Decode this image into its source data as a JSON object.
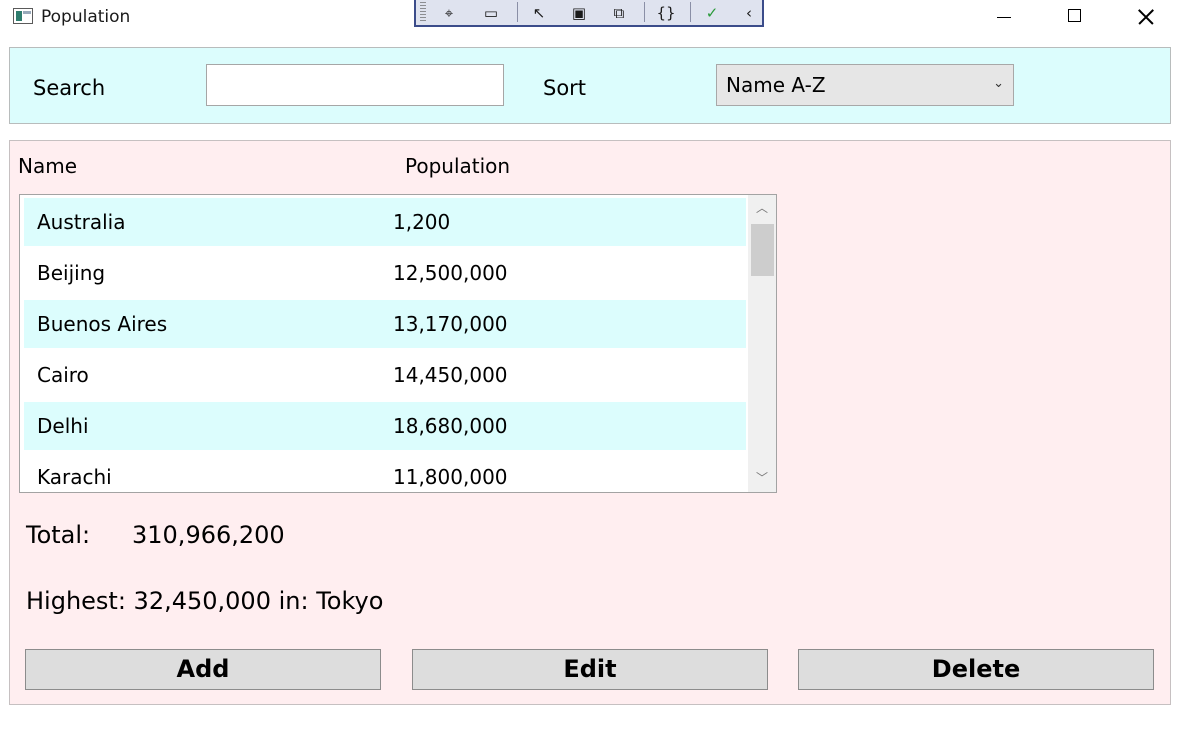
{
  "window": {
    "title": "Population"
  },
  "devtools": {
    "buttons": [
      {
        "icon": "select-element-icon",
        "glyph": "⌖"
      },
      {
        "icon": "video-icon",
        "glyph": "▭"
      },
      {
        "icon": "pointer-select-icon",
        "glyph": "↖"
      },
      {
        "icon": "frame-icon",
        "glyph": "▣"
      },
      {
        "icon": "display-pointer-icon",
        "glyph": "⧉"
      },
      {
        "icon": "binding-icon",
        "glyph": "{}"
      },
      {
        "icon": "check-circle-icon",
        "glyph": "✓"
      },
      {
        "icon": "collapse-icon",
        "glyph": "‹"
      }
    ]
  },
  "search": {
    "label": "Search",
    "value": "",
    "placeholder": ""
  },
  "sort": {
    "label": "Sort",
    "selected": "Name A-Z"
  },
  "list": {
    "headers": {
      "name": "Name",
      "population": "Population"
    },
    "rows": [
      {
        "name": "Australia",
        "population": "1,200"
      },
      {
        "name": "Beijing",
        "population": "12,500,000"
      },
      {
        "name": "Buenos Aires",
        "population": "13,170,000"
      },
      {
        "name": "Cairo",
        "population": "14,450,000"
      },
      {
        "name": "Delhi",
        "population": "18,680,000"
      },
      {
        "name": "Karachi",
        "population": "11,800,000"
      }
    ]
  },
  "stats": {
    "total_label": "Total:",
    "total_value": "310,966,200",
    "highest_text": "Highest: 32,450,000 in: Tokyo"
  },
  "actions": {
    "add": "Add",
    "edit": "Edit",
    "delete": "Delete"
  },
  "colors": {
    "search_panel_bg": "#dcfdfd",
    "main_panel_bg": "#ffeef0",
    "alt_row_bg": "#dcfdfd",
    "button_bg": "#dddddd"
  }
}
